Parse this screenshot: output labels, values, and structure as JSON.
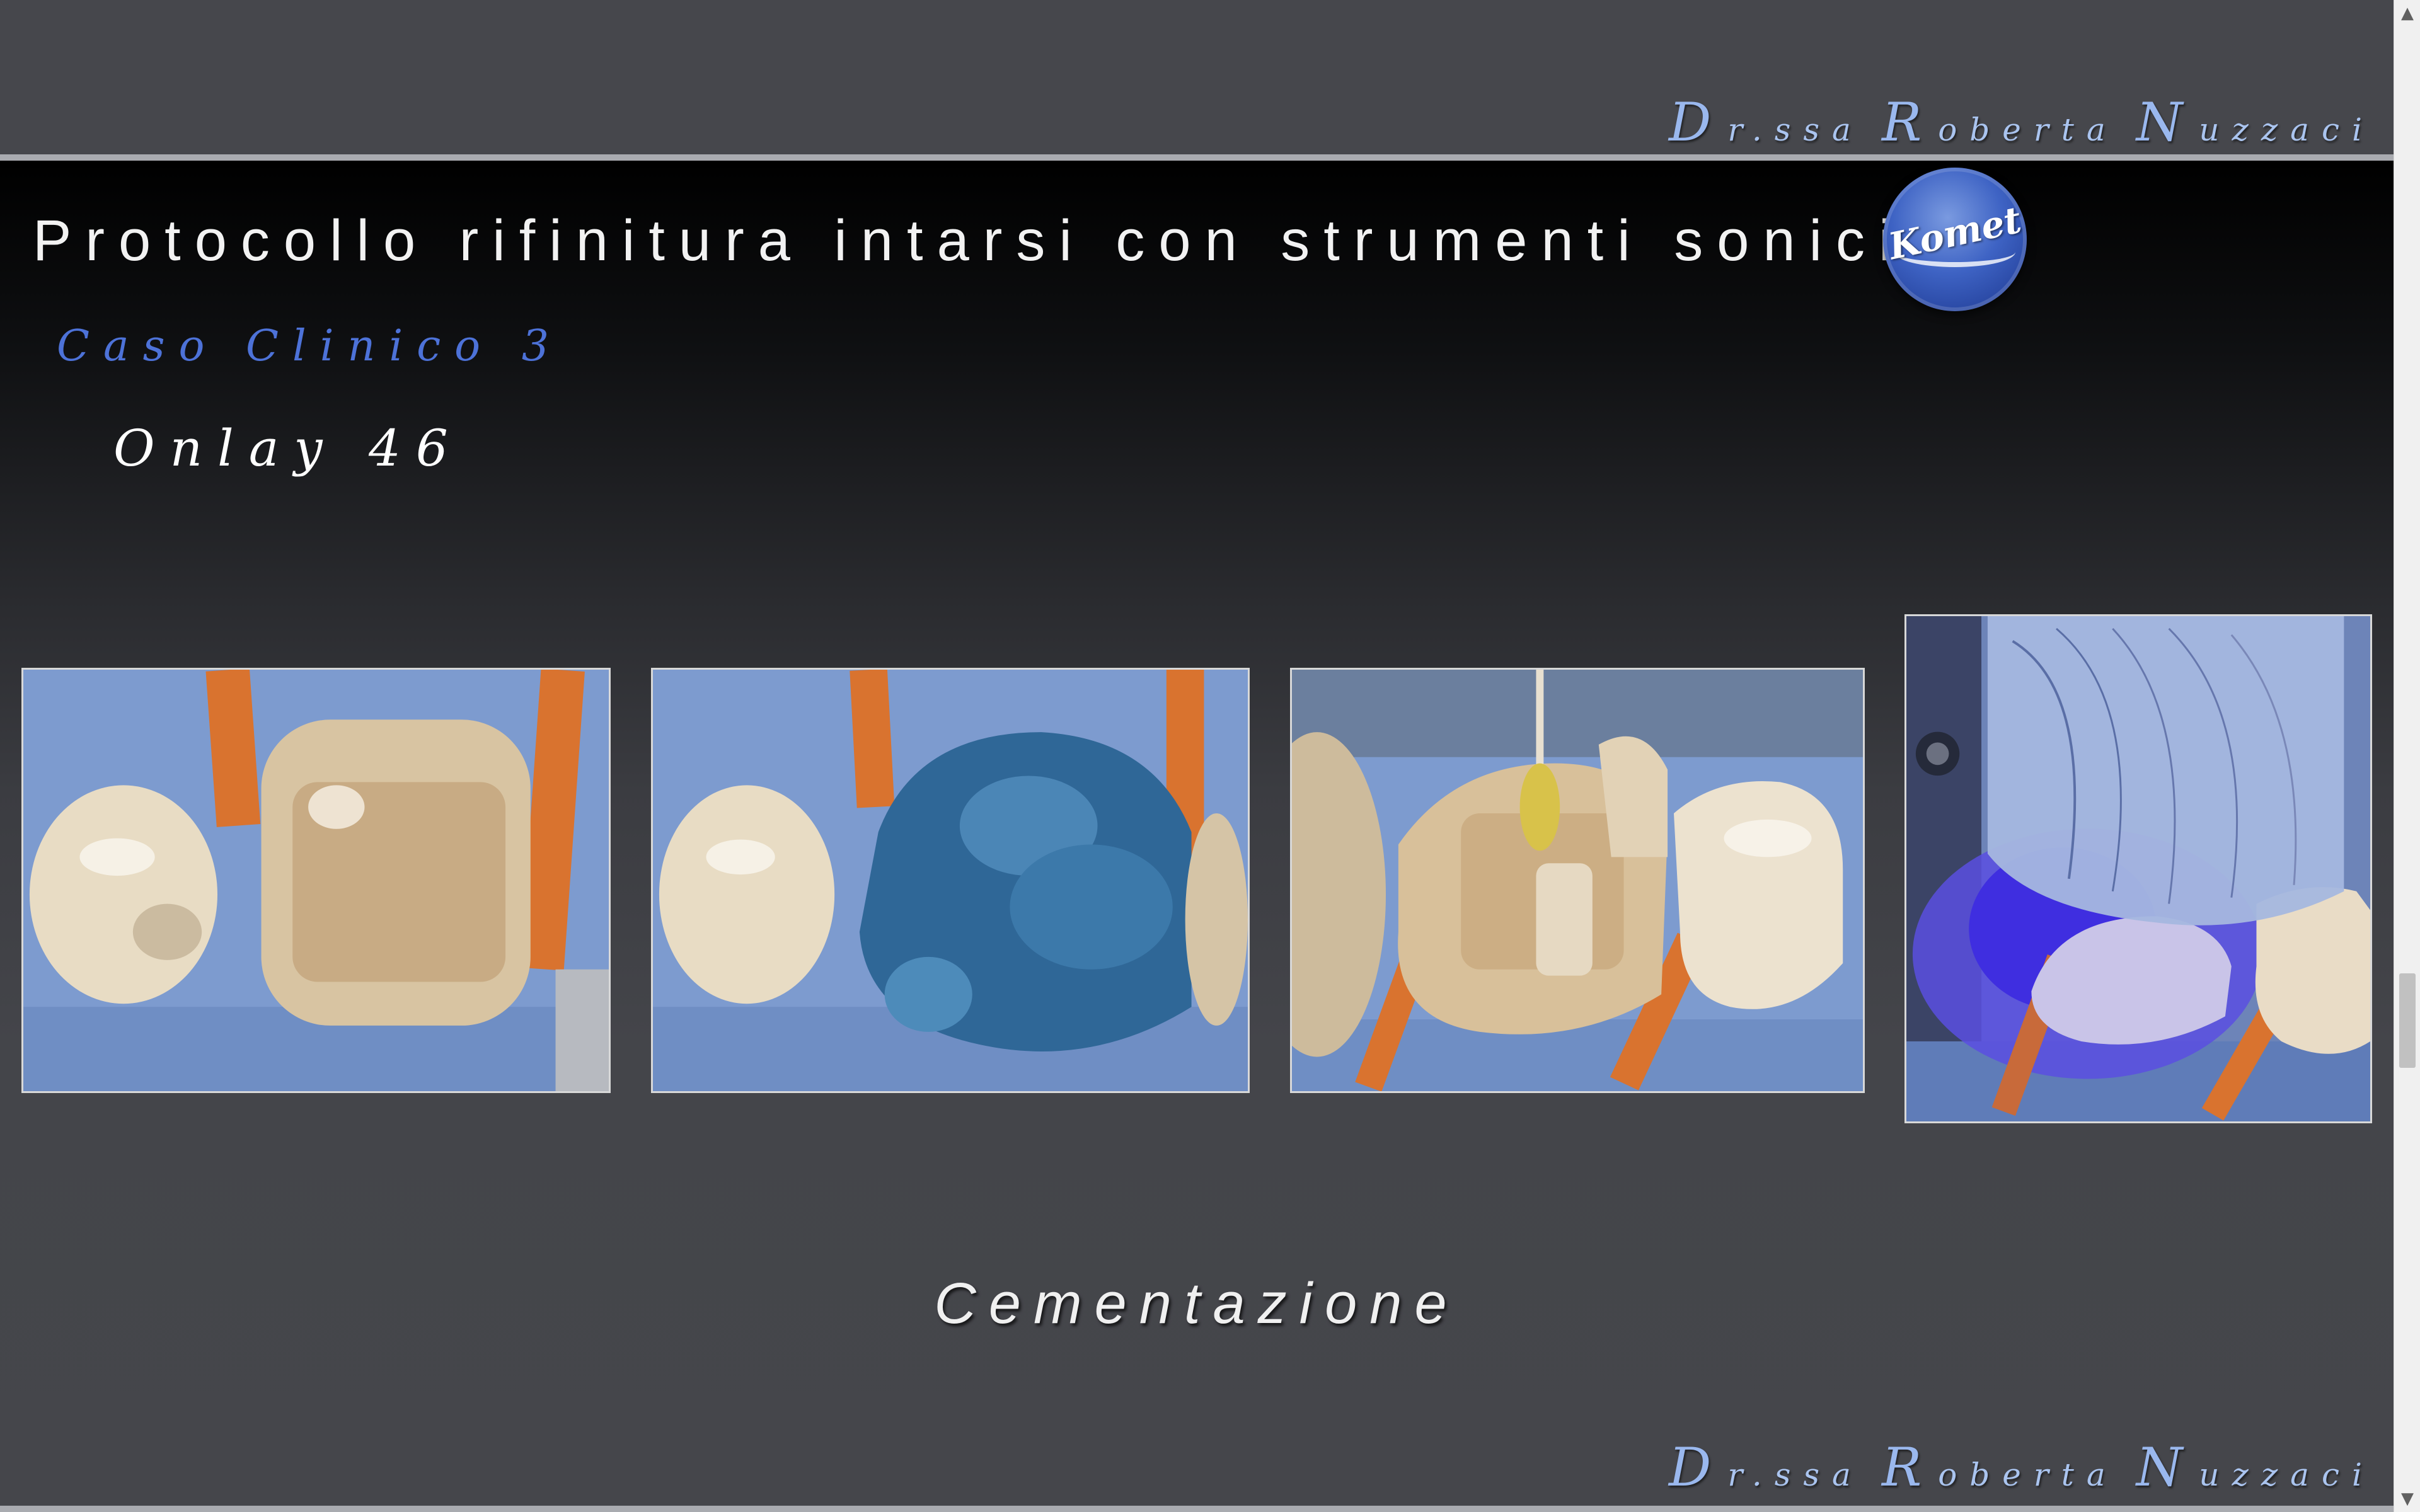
{
  "header": {
    "author_first_initial": "D",
    "author_first_rest": "r.ssa",
    "author_mid_initial": "R",
    "author_mid_rest": "oberta",
    "author_last_initial": "N",
    "author_last_rest": "uzzaci"
  },
  "slide": {
    "title": "Protocollo rifinitura intarsi con strumenti sonici",
    "logo_text": "Komet",
    "case_label": "Caso Clinico 3",
    "subtitle": "Onlay 46",
    "caption": "Cementazione",
    "photos": [
      {
        "name": "photo-1",
        "subject": "prepared tooth with rubber dam"
      },
      {
        "name": "photo-2",
        "subject": "tooth covered with blue etching gel"
      },
      {
        "name": "photo-3",
        "subject": "applicator brush on onlay"
      },
      {
        "name": "photo-4",
        "subject": "curing light polymerization"
      }
    ]
  },
  "footer": {
    "author_first_initial": "D",
    "author_first_rest": "r.ssa",
    "author_mid_initial": "R",
    "author_mid_rest": "oberta",
    "author_last_initial": "N",
    "author_last_rest": "uzzaci"
  },
  "scrollbar": {
    "up_arrow": "▲",
    "down_arrow": "▼"
  },
  "colors": {
    "background": "#45464b",
    "accent_blue": "#4d72d8",
    "signature": "#aac4ef",
    "dam_blue": "#7f9fd2"
  }
}
